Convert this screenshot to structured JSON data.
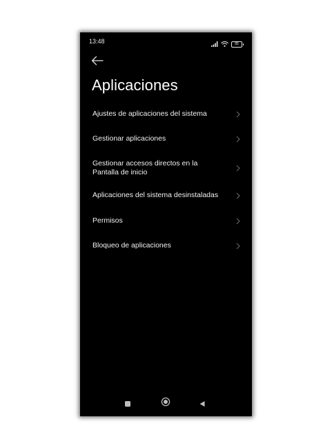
{
  "status_bar": {
    "time": "13:48",
    "battery_level": "85",
    "icons": [
      "signal-icon",
      "wifi-icon",
      "battery-icon"
    ]
  },
  "header": {
    "back_icon": "arrow-left-icon",
    "title": "Aplicaciones"
  },
  "menu": {
    "items": [
      {
        "label": "Ajustes de aplicaciones del sistema"
      },
      {
        "label": "Gestionar aplicaciones"
      },
      {
        "label": "Gestionar accesos directos en la Pantalla de inicio"
      },
      {
        "label": "Aplicaciones del sistema desinstaladas"
      },
      {
        "label": "Permisos"
      },
      {
        "label": "Bloqueo de aplicaciones"
      }
    ],
    "chevron_icon": "chevron-right-icon"
  },
  "nav_bar": {
    "buttons": [
      "recents-square-icon",
      "home-circle-icon",
      "back-triangle-icon"
    ]
  },
  "colors": {
    "background": "#000000",
    "text": "#f2f2f2",
    "chevron": "#6e6e6e",
    "nav_icons": "#bdbdbd"
  }
}
